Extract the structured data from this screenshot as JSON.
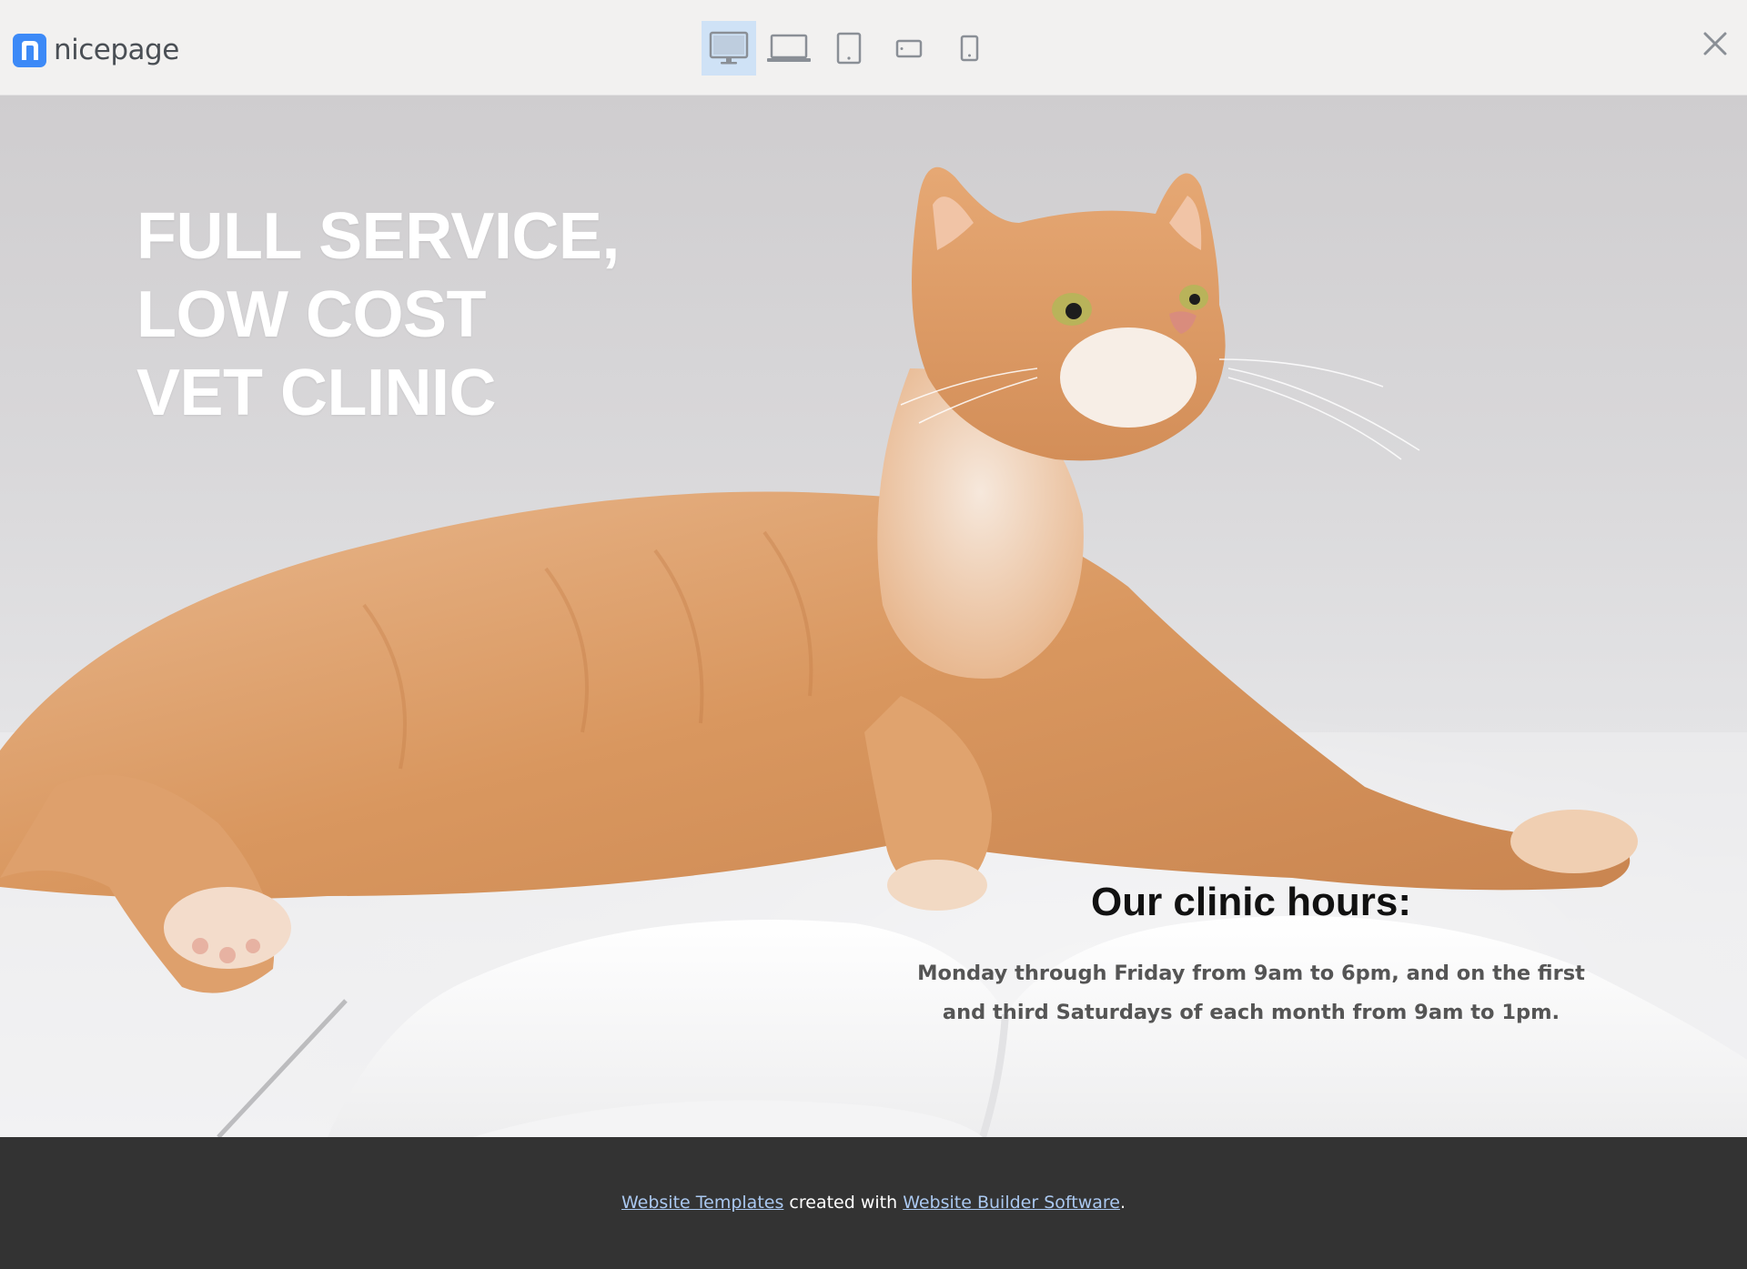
{
  "app": {
    "logo_text": "nicepage"
  },
  "toolbar": {
    "devices": [
      {
        "name": "desktop",
        "active": true
      },
      {
        "name": "laptop",
        "active": false
      },
      {
        "name": "tablet",
        "active": false
      },
      {
        "name": "phone-landscape",
        "active": false
      },
      {
        "name": "phone",
        "active": false
      }
    ],
    "close_icon": "close-icon"
  },
  "hero": {
    "headline": [
      "FULL SERVICE,",
      "LOW COST",
      "VET CLINIC"
    ],
    "hours_title": "Our clinic hours:",
    "hours_text": "Monday through Friday from 9am to 6pm, and on the first and third Saturdays of each month from 9am to 1pm."
  },
  "footer": {
    "link1": "Website Templates",
    "middle": " created with ",
    "link2": "Website Builder Software",
    "end": "."
  },
  "colors": {
    "accent": "#3d8af7",
    "active_device_bg": "#cfe2f6",
    "footer_bg": "#333333",
    "footer_link": "#aac8f0"
  }
}
